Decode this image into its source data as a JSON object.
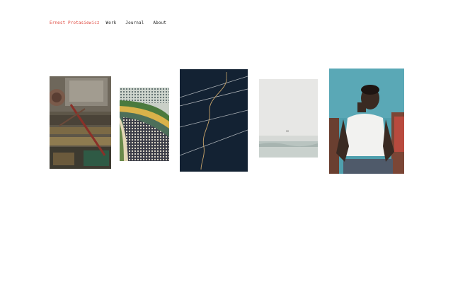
{
  "header": {
    "site_name": "Ernest Protasiewicz",
    "nav": [
      {
        "label": "Work"
      },
      {
        "label": "Journal"
      },
      {
        "label": "About"
      }
    ]
  },
  "colors": {
    "accent": "#e0493f",
    "text": "#222222",
    "background": "#ffffff"
  },
  "gallery": {
    "items": [
      {
        "subject": "rusty-machinery"
      },
      {
        "subject": "mosaic-table"
      },
      {
        "subject": "wires-at-night"
      },
      {
        "subject": "foggy-sea"
      },
      {
        "subject": "man-in-white-shirt"
      }
    ]
  }
}
